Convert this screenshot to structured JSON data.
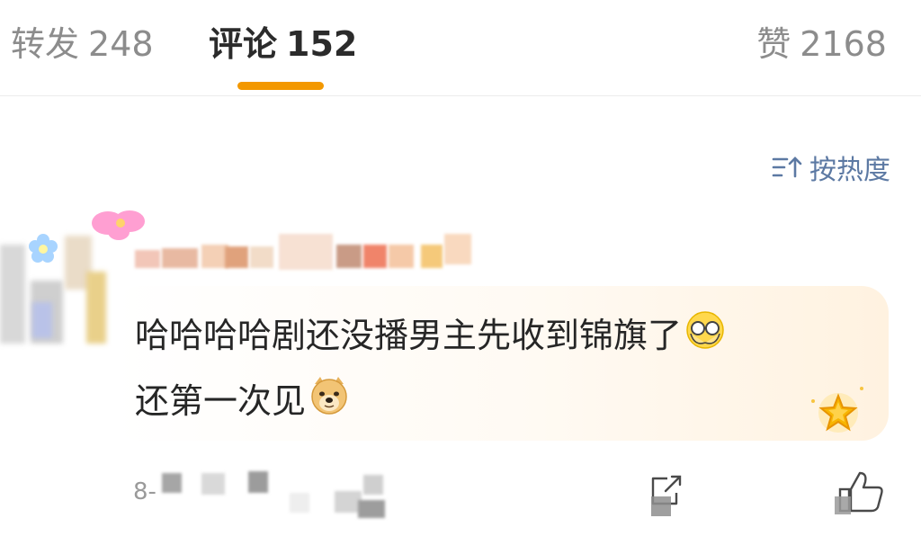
{
  "tabs": [
    {
      "label": "转发",
      "count": "248"
    },
    {
      "label": "评论",
      "count": "152"
    },
    {
      "label": "赞",
      "count": "2168"
    }
  ],
  "sort": {
    "label": "按热度",
    "icon": "sort-icon"
  },
  "comment": {
    "line1": "哈哈哈哈剧还没播男主先收到锦旗了",
    "line2": "还第一次见",
    "emoji1": "glasses-emoji-icon",
    "emoji2": "doge-emoji-icon"
  },
  "footer": {
    "date_prefix": "8-"
  },
  "colors": {
    "accent": "#f39800",
    "sort": "#5c79a3",
    "text": "#262626",
    "muted": "#8c8c8c"
  }
}
